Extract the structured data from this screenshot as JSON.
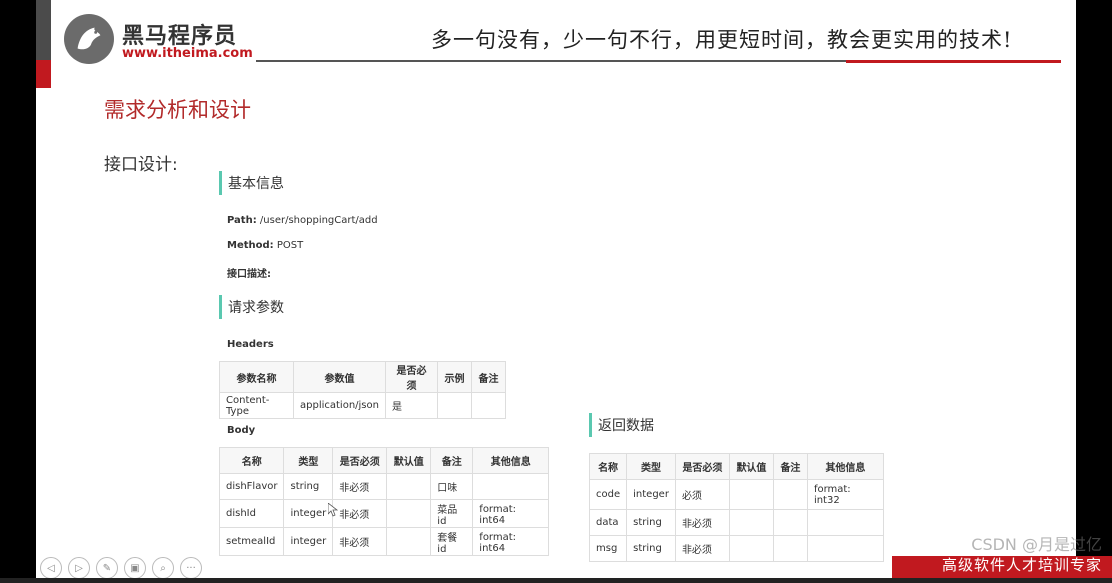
{
  "header": {
    "brand": "黑马程序员",
    "url": "www.itheima.com",
    "slogan": "多一句没有，少一句不行，用更短时间，教会更实用的技术!"
  },
  "title": "需求分析和设计",
  "subtitle": "接口设计:",
  "basic": {
    "heading": "基本信息",
    "path_label": "Path:",
    "path_value": "/user/shoppingCart/add",
    "method_label": "Method:",
    "method_value": "POST",
    "desc_label": "接口描述:"
  },
  "request": {
    "heading": "请求参数",
    "headers_label": "Headers",
    "headers_table": {
      "columns": [
        "参数名称",
        "参数值",
        "是否必须",
        "示例",
        "备注"
      ],
      "rows": [
        [
          "Content-Type",
          "application/json",
          "是",
          "",
          ""
        ]
      ]
    },
    "body_label": "Body",
    "body_table": {
      "columns": [
        "名称",
        "类型",
        "是否必须",
        "默认值",
        "备注",
        "其他信息"
      ],
      "rows": [
        [
          "dishFlavor",
          "string",
          "非必须",
          "",
          "口味",
          ""
        ],
        [
          "dishId",
          "integer",
          "非必须",
          "",
          "菜品id",
          "format: int64"
        ],
        [
          "setmealId",
          "integer",
          "非必须",
          "",
          "套餐id",
          "format: int64"
        ]
      ]
    }
  },
  "response": {
    "heading": "返回数据",
    "table": {
      "columns": [
        "名称",
        "类型",
        "是否必须",
        "默认值",
        "备注",
        "其他信息"
      ],
      "rows": [
        [
          "code",
          "integer",
          "必须",
          "",
          "",
          "format: int32"
        ],
        [
          "data",
          "string",
          "非必须",
          "",
          "",
          ""
        ],
        [
          "msg",
          "string",
          "非必须",
          "",
          "",
          ""
        ]
      ]
    }
  },
  "footer": {
    "tagline": "高级软件人才培训专家",
    "watermark": "CSDN @月是过亿"
  },
  "toolbar": [
    "◁",
    "▷",
    "✎",
    "▣",
    "⌕",
    "···"
  ]
}
